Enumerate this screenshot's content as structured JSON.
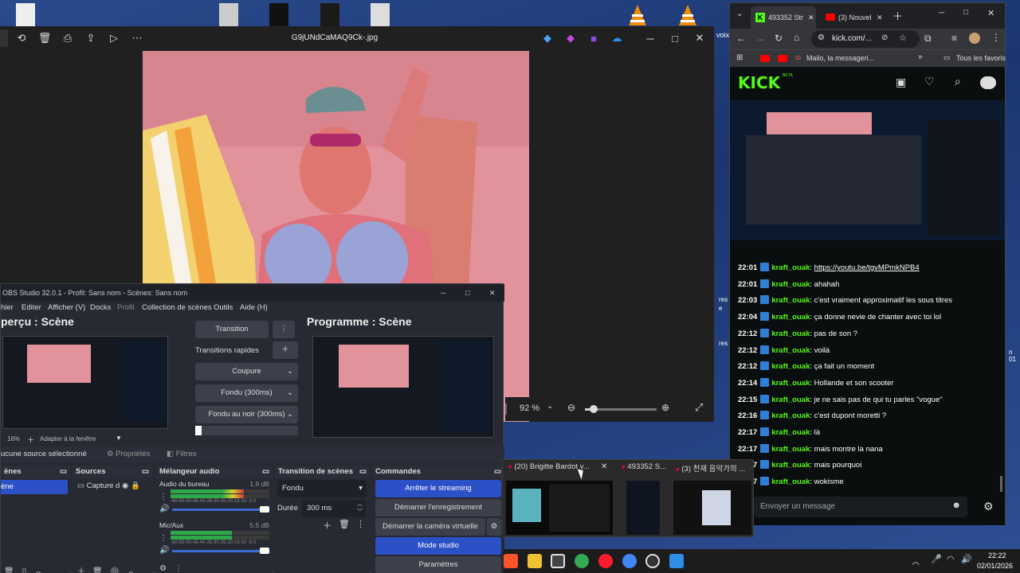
{
  "viewer": {
    "filename": "G9jUNdCaMAQ9Ck-.jpg",
    "zoom": "92 %",
    "zoom_fraction": 0.12
  },
  "desktop": {
    "side_labels": [
      "voix",
      "res",
      "e",
      "res",
      "n 01"
    ]
  },
  "obs": {
    "title": "OBS Studio 32.0.1 - Profil: Sans nom - Scènes: Sans nom",
    "menu": [
      "hier",
      "Editer",
      "Afficher (V)",
      "Docks",
      "Profil",
      "Collection de scènes",
      "Outils",
      "Aide (H)"
    ],
    "preview_title": "perçu : Scène",
    "program_title": "Programme : Scène",
    "transition_btn": "Transition",
    "quick_transitions": "Transitions rapides",
    "quick": [
      "Coupure",
      "Fondu (300ms)",
      "Fondu au noir (300ms)"
    ],
    "zoom_pct": "16%",
    "fit_window": "Adapter à la fenêtre",
    "no_source": "ucune source sélectionné",
    "properties": "Propriétés",
    "filters": "Filtres",
    "docks": {
      "scenes": {
        "title": "ènes",
        "item": "ène"
      },
      "sources": {
        "title": "Sources",
        "item": "Capture d"
      },
      "mixer": {
        "title": "Mélangeur audio",
        "channels": [
          {
            "name": "Audio du bureau",
            "db": "1.9 dB",
            "level": 0.74
          },
          {
            "name": "Mic/Aux",
            "db": "5.5 dB",
            "level": 0.62
          }
        ],
        "scale": "-60-55-50-45-40-35-30-25-20-15-10 -5  0"
      },
      "transitions": {
        "title": "Transition de scènes",
        "select": "Fondu",
        "duration_label": "Durée",
        "duration": "300 ms"
      },
      "controls": {
        "title": "Commandes",
        "buttons": [
          "Arrêter le streaming",
          "Démarrer l'enregistrement",
          "Démarrer la caméra virtuelle",
          "Mode studio",
          "Paramètres"
        ]
      }
    }
  },
  "browser": {
    "tabs": [
      "493352 Str",
      "(3) Nouvel"
    ],
    "url": "kick.com/...",
    "bookmarks": [
      "Mailo, la messageri...",
      "Tous les favoris"
    ],
    "logo": "KICK",
    "logo_beta": "BETA",
    "chat": [
      {
        "time": "22:01",
        "user": "kraft_ouak",
        "msg": "https://youtu.be/tgvMPmkNPB4"
      },
      {
        "time": "22:01",
        "user": "kraft_ouak",
        "msg": "ahahah"
      },
      {
        "time": "22:03",
        "user": "kraft_ouak",
        "msg": "c'est vraiment approximatif les sous titres"
      },
      {
        "time": "22:04",
        "user": "kraft_ouak",
        "msg": "ça donne nevie de chanter avec toi lol"
      },
      {
        "time": "22:12",
        "user": "kraft_ouak",
        "msg": "pas de son ?"
      },
      {
        "time": "22:12",
        "user": "kraft_ouak",
        "msg": "voilà"
      },
      {
        "time": "22:12",
        "user": "kraft_ouak",
        "msg": "ça fait un moment"
      },
      {
        "time": "22:14",
        "user": "kraft_ouak",
        "msg": "Hollande et son scooter"
      },
      {
        "time": "22:15",
        "user": "kraft_ouak",
        "msg": "je ne sais pas de qui tu parles \"vogue\""
      },
      {
        "time": "22:16",
        "user": "kraft_ouak",
        "msg": "c'est dupont moretti ?"
      },
      {
        "time": "22:17",
        "user": "kraft_ouak",
        "msg": "là"
      },
      {
        "time": "22:17",
        "user": "kraft_ouak",
        "msg": "mais montre la nana"
      },
      {
        "time": "22:17",
        "user": "kraft_ouak",
        "msg": "mais pourquoi"
      },
      {
        "time": "22:17",
        "user": "kraft_ouak",
        "msg": "wokisme"
      }
    ],
    "chat_placeholder": "Envoyer un message"
  },
  "popup": {
    "tabs": [
      "(20) Brigitte Bardot v...",
      "493352 S...",
      "(3) 천재 음악가의 ..."
    ]
  },
  "taskbar": {
    "time": "22:22",
    "date": "02/01/2026"
  }
}
